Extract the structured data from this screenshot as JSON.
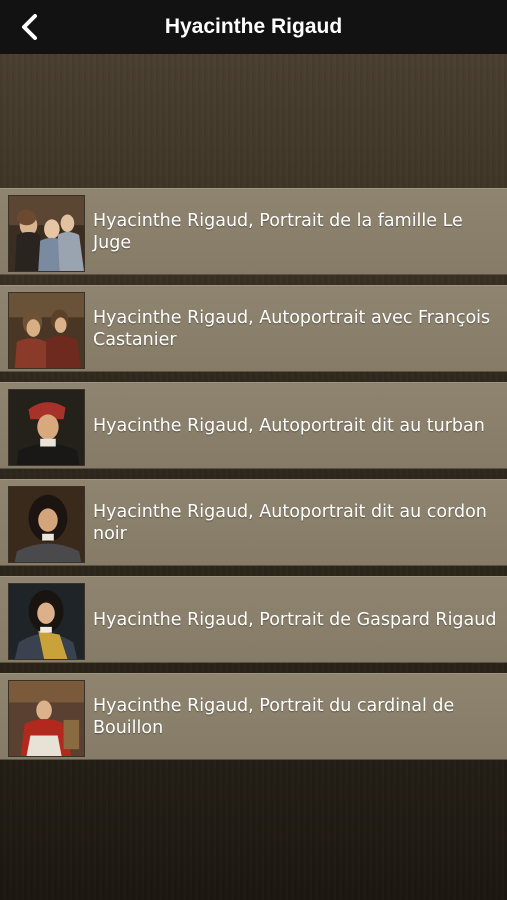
{
  "navbar": {
    "title": "Hyacinthe Rigaud",
    "back_icon": "chevron-left-icon"
  },
  "items": [
    {
      "label": "Hyacinthe Rigaud, Portrait de la famille Le Juge",
      "thumbnail": "portrait-famille-le-juge"
    },
    {
      "label": "Hyacinthe Rigaud, Autoportrait avec François Castanier",
      "thumbnail": "autoportrait-castanier"
    },
    {
      "label": "Hyacinthe Rigaud, Autoportrait dit au turban",
      "thumbnail": "autoportrait-turban"
    },
    {
      "label": "Hyacinthe Rigaud, Autoportrait dit au cordon noir",
      "thumbnail": "autoportrait-cordon-noir"
    },
    {
      "label": "Hyacinthe Rigaud, Portrait de Gaspard Rigaud",
      "thumbnail": "portrait-gaspard-rigaud"
    },
    {
      "label": "Hyacinthe Rigaud, Portrait du cardinal de Bouillon",
      "thumbnail": "portrait-cardinal-bouillon"
    }
  ],
  "colors": {
    "navbar_bg": "#121212",
    "row_bg": "#8a806c",
    "text": "#ffffff"
  }
}
